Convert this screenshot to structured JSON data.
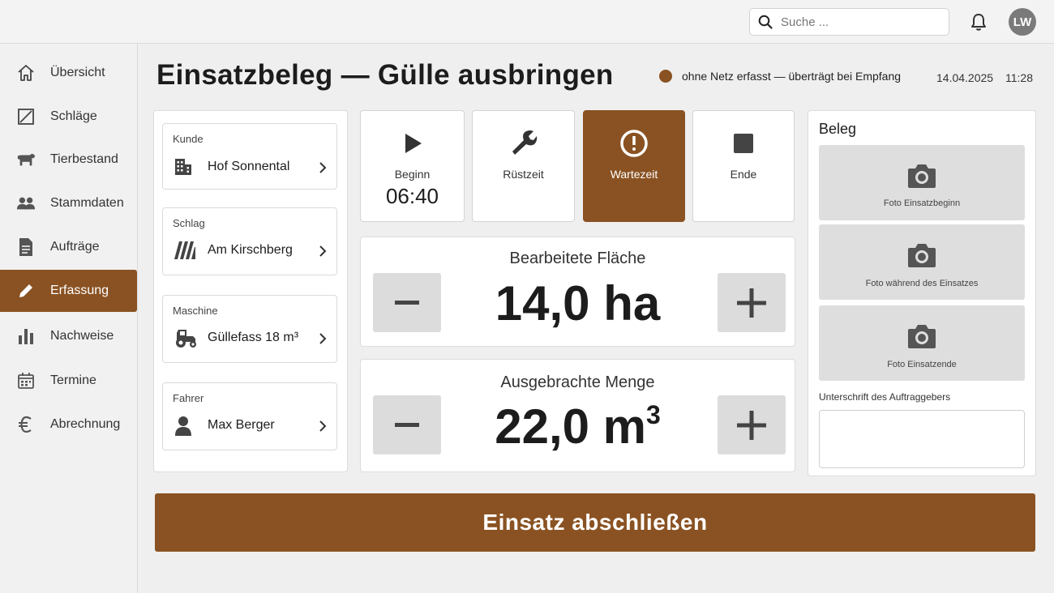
{
  "header": {
    "search_placeholder": "Suche ...",
    "avatar_initials": "LW"
  },
  "sidebar": {
    "items": [
      {
        "label": "Übersicht",
        "icon": "home-icon"
      },
      {
        "label": "Schläge",
        "icon": "field-icon"
      },
      {
        "label": "Tierbestand",
        "icon": "cow-icon"
      },
      {
        "label": "Stammdaten",
        "icon": "people-icon"
      },
      {
        "label": "Aufträge",
        "icon": "document-icon"
      },
      {
        "label": "Erfassung",
        "icon": "pencil-icon",
        "active": true
      },
      {
        "label": "Nachweise",
        "icon": "bar-chart-icon"
      },
      {
        "label": "Termine",
        "icon": "calendar-icon"
      },
      {
        "label": "Abrechnung",
        "icon": "euro-icon"
      }
    ]
  },
  "page": {
    "title": "Einsatzbeleg — Gülle ausbringen",
    "status_text": "ohne Netz erfasst — überträgt bei Empfang",
    "date": "14.04.2025",
    "time": "11:28"
  },
  "details": {
    "customer": {
      "label": "Kunde",
      "value": "Hof Sonnental"
    },
    "field": {
      "label": "Schlag",
      "value": "Am Kirschberg"
    },
    "machine": {
      "label": "Maschine",
      "value": "Güllefass 18 m³"
    },
    "driver": {
      "label": "Fahrer",
      "value": "Max Berger"
    }
  },
  "time_buttons": {
    "start": {
      "label": "Beginn",
      "value": "06:40"
    },
    "setup": {
      "label": "Rüstzeit"
    },
    "waiting": {
      "label": "Wartezeit",
      "active": true
    },
    "end": {
      "label": "Ende"
    }
  },
  "area_counter": {
    "title": "Bearbeitete Fläche",
    "value": "14,0 ha"
  },
  "amount_counter": {
    "title": "Ausgebrachte Menge",
    "value": "22,0 m",
    "unit_exponent": "3"
  },
  "receipt": {
    "title": "Beleg",
    "photo_start": "Foto Einsatzbeginn",
    "photo_during": "Foto während des Einsatzes",
    "photo_end": "Foto Einsatzende",
    "signature_label": "Unterschrift des Auftraggebers"
  },
  "finish_button": "Einsatz abschließen",
  "colors": {
    "accent": "#8a5222",
    "background": "#efefef"
  }
}
